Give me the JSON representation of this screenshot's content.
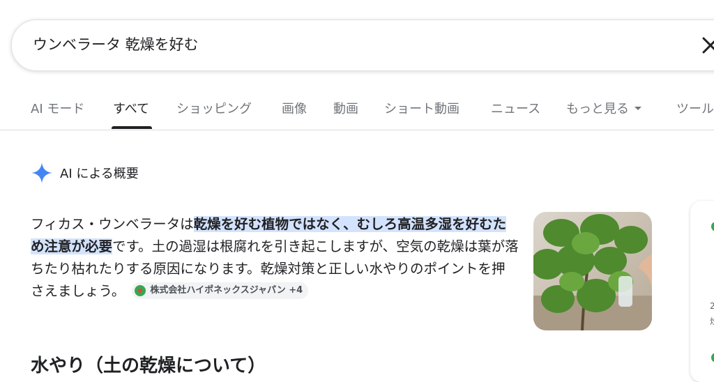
{
  "search": {
    "query": "ウンベラータ 乾燥を好む"
  },
  "tabs": [
    {
      "label": "AI モード"
    },
    {
      "label": "すべて"
    },
    {
      "label": "ショッピング"
    },
    {
      "label": "画像"
    },
    {
      "label": "動画"
    },
    {
      "label": "ショート動画"
    },
    {
      "label": "ニュース"
    },
    {
      "label": "もっと見る"
    },
    {
      "label": "ツール"
    }
  ],
  "ai_overview": {
    "title": "AI による概要",
    "text_intro": "フィカス・ウンベラータは",
    "text_highlight": "乾燥を好む植物ではなく、むしろ高温多湿を好むため注意が必要",
    "text_rest": "です。土の過湿は根腐れを引き起こしますが、空気の乾燥は葉が落ちたり枯れたりする原因になります。乾燥対策と正しい水やりのポイントを押さえましょう。",
    "source_chip": "株式会社ハイポネックスジャパン +4",
    "section_heading": "水やり（土の乾燥について）"
  },
  "side_card": {
    "line1": "2",
    "line2": "炒"
  },
  "colors": {
    "highlight": "#d3e3fd",
    "ai_star": "#4285f4",
    "tab_active": "#202124"
  }
}
